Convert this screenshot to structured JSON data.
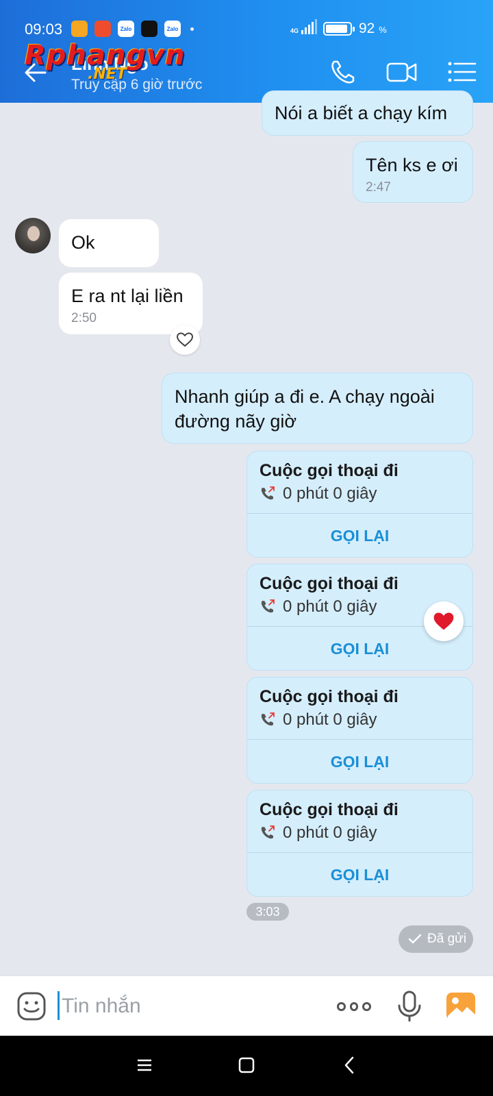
{
  "status_bar": {
    "time": "09:03",
    "network": "4G",
    "battery_percent": "92",
    "battery_unit": "%",
    "battery_level": 0.92,
    "notification_icons": [
      "app-icon",
      "shopee-icon",
      "zalo-icon",
      "tiktok-icon",
      "zalo-icon"
    ],
    "notification_labels": [
      "",
      "",
      "Zalo",
      "",
      "Zalo"
    ]
  },
  "watermark": {
    "text": "Rphangvn",
    "suffix": ".NET"
  },
  "header": {
    "contact_name": "Linh Ngo",
    "contact_status": "Truy cập 6 giờ trước"
  },
  "messages": [
    {
      "from": "me",
      "text": "Nói a biết a chạy kím"
    },
    {
      "from": "me",
      "text": "Tên ks e ơi",
      "time": "2:47"
    },
    {
      "from": "them",
      "text": "Ok"
    },
    {
      "from": "them",
      "text": "E ra nt lại liền",
      "time": "2:50"
    },
    {
      "from": "me",
      "text": "Nhanh giúp a đi e. A chạy ngoài đường nãy giờ"
    }
  ],
  "calls": [
    {
      "title": "Cuộc gọi thoại đi",
      "duration": "0 phút 0 giây",
      "action": "GỌI LẠI"
    },
    {
      "title": "Cuộc gọi thoại đi",
      "duration": "0 phút 0 giây",
      "action": "GỌI LẠI"
    },
    {
      "title": "Cuộc gọi thoại đi",
      "duration": "0 phút 0 giây",
      "action": "GỌI LẠI"
    },
    {
      "title": "Cuộc gọi thoại đi",
      "duration": "0 phút 0 giây",
      "action": "GỌI LẠI"
    }
  ],
  "group_time": "3:03",
  "sent_status": "Đã gửi",
  "composer": {
    "placeholder": "Tin nhắn"
  },
  "colors": {
    "header_start": "#1e6ed8",
    "header_end": "#29a3f7",
    "my_bubble": "#d5eefc",
    "their_bubble": "#ffffff",
    "accent": "#1a8fd6",
    "background": "#e4e8ee"
  }
}
